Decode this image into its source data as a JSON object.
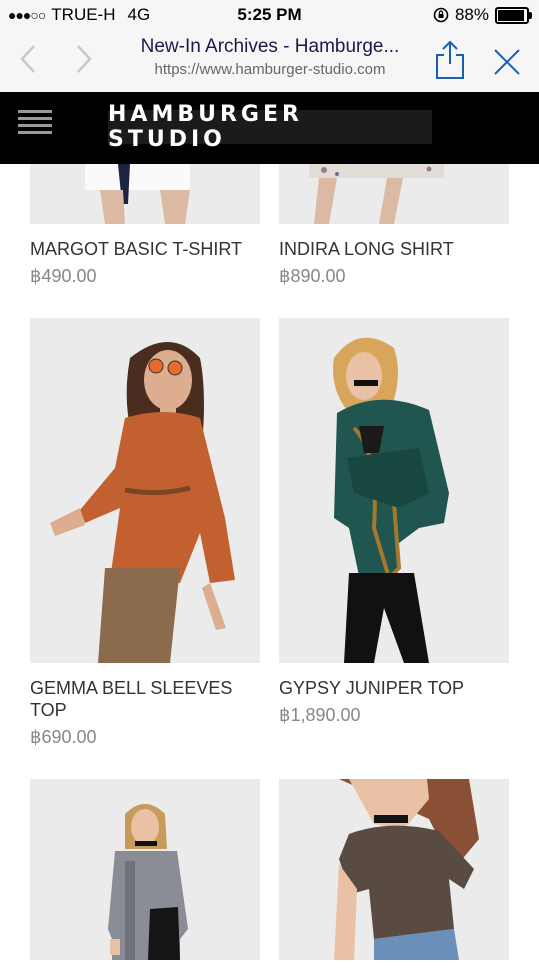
{
  "status": {
    "carrier": "TRUE-H",
    "network": "4G",
    "time": "5:25 PM",
    "battery": "88%",
    "battery_level": 0.88
  },
  "browser": {
    "title": "New-In Archives - Hamburge...",
    "url": "https://www.hamburger-studio.com"
  },
  "header": {
    "logo": "HAMBURGER STUDIO"
  },
  "products": [
    {
      "name": "MARGOT BASIC T-SHIRT",
      "price": "฿490.00"
    },
    {
      "name": "INDIRA LONG SHIRT",
      "price": "฿890.00"
    },
    {
      "name": "GEMMA BELL SLEEVES TOP",
      "price": "฿690.00"
    },
    {
      "name": "GYPSY JUNIPER TOP",
      "price": "฿1,890.00"
    },
    {
      "name": "",
      "price": ""
    },
    {
      "name": "",
      "price": ""
    }
  ]
}
